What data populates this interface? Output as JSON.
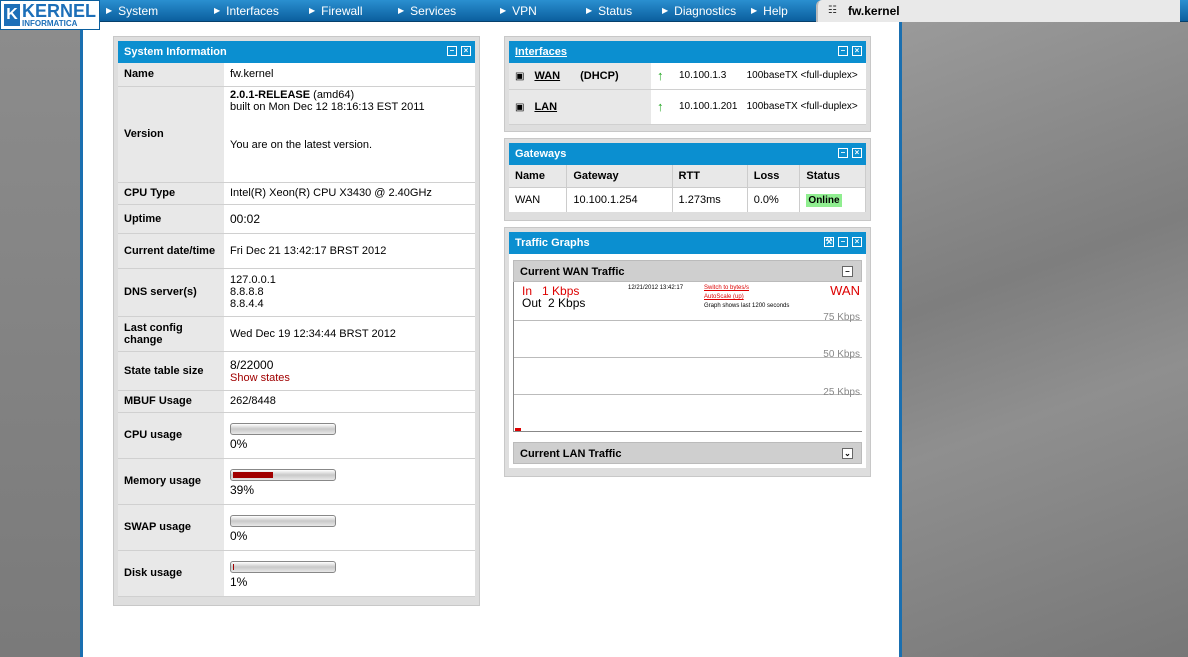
{
  "brand": {
    "logo_letter": "K",
    "logo_top": "KERNEL",
    "logo_bottom": "INFORMATICA"
  },
  "nav": [
    "System",
    "Interfaces",
    "Firewall",
    "Services",
    "VPN",
    "Status",
    "Diagnostics",
    "Help"
  ],
  "hostname": "fw.kernel",
  "system_info": {
    "title": "System Information",
    "rows": [
      {
        "label": "Name",
        "value": "fw.kernel"
      },
      {
        "label": "Version",
        "value_bold": "2.0.1-RELEASE",
        "value_suffix": " (amd64)",
        "line2": "built on Mon Dec 12 18:16:13 EST 2011",
        "line3": "You are on the latest version."
      },
      {
        "label": "CPU Type",
        "value": "Intel(R) Xeon(R) CPU X3430 @ 2.40GHz"
      },
      {
        "label": "Uptime",
        "value": "00:02"
      },
      {
        "label": "Current date/time",
        "value": "Fri Dec 21 13:42:17 BRST 2012"
      },
      {
        "label": "DNS server(s)",
        "values": [
          "127.0.0.1",
          "8.8.8.8",
          "8.8.4.4"
        ]
      },
      {
        "label": "Last config change",
        "value": "Wed Dec 19 12:34:44 BRST 2012"
      },
      {
        "label": "State table size",
        "value": "8/22000",
        "link": "Show states"
      },
      {
        "label": "MBUF Usage",
        "value": "262/8448"
      },
      {
        "label": "CPU usage",
        "value": "0%",
        "fraction": 0.0
      },
      {
        "label": "Memory usage",
        "value": "39%",
        "fraction": 0.39
      },
      {
        "label": "SWAP usage",
        "value": "0%",
        "fraction": 0.0
      },
      {
        "label": "Disk usage",
        "value": "1%",
        "fraction": 0.01
      }
    ]
  },
  "interfaces": {
    "title": "Interfaces",
    "rows": [
      {
        "name": "WAN",
        "type": "(DHCP)",
        "ip": "10.100.1.3",
        "media": "100baseTX <full-duplex>"
      },
      {
        "name": "LAN",
        "type": "",
        "ip": "10.100.1.201",
        "media": "100baseTX <full-duplex>"
      }
    ]
  },
  "gateways": {
    "title": "Gateways",
    "headers": [
      "Name",
      "Gateway",
      "RTT",
      "Loss",
      "Status"
    ],
    "rows": [
      {
        "name": "WAN",
        "gateway": "10.100.1.254",
        "rtt": "1.273ms",
        "loss": "0.0%",
        "status": "Online"
      }
    ]
  },
  "traffic": {
    "title": "Traffic Graphs",
    "wan_title": "Current WAN Traffic",
    "lan_title": "Current LAN Traffic",
    "in_label": "In",
    "in_value": "1 Kbps",
    "out_label": "Out",
    "out_value": "2 Kbps",
    "timestamp": "12/21/2012 13:42:17",
    "switch_link": "Switch to bytes/s",
    "autoscale": "AutoScale (up)",
    "note": "Graph shows last 1200 seconds",
    "iface": "WAN",
    "ticks": [
      "75 Kbps",
      "50 Kbps",
      "25 Kbps"
    ]
  },
  "colors": {
    "accent": "#0b8fd0",
    "nav": "#0b5f9e",
    "online": "#90ee90",
    "bar_fill": "#a10000"
  }
}
